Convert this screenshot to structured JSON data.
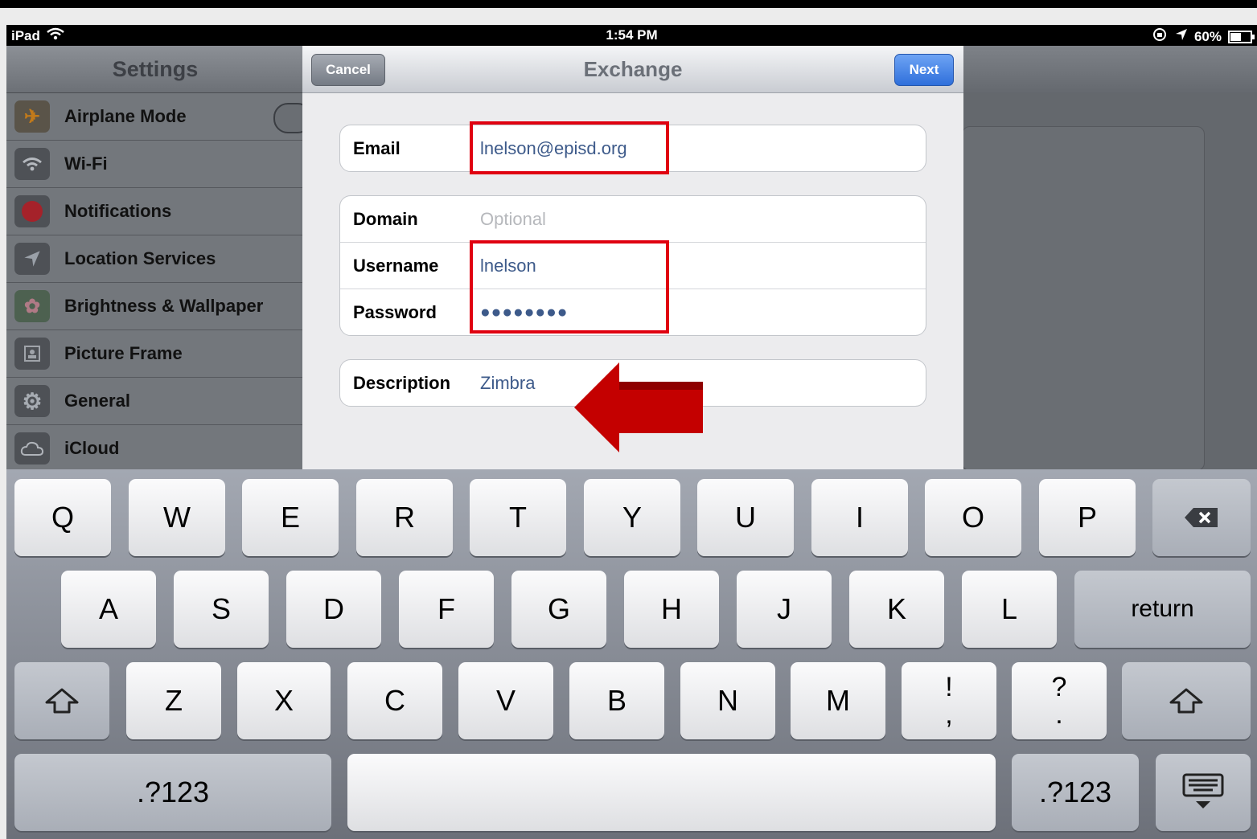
{
  "statusbar": {
    "device": "iPad",
    "time": "1:54 PM",
    "battery": "60%",
    "battery_level": 0.6
  },
  "settings": {
    "title": "Settings",
    "items": [
      {
        "label": "Airplane Mode",
        "icon": "airplane-icon"
      },
      {
        "label": "Wi-Fi",
        "icon": "wifi-icon"
      },
      {
        "label": "Notifications",
        "icon": "notifications-icon"
      },
      {
        "label": "Location Services",
        "icon": "location-icon"
      },
      {
        "label": "Brightness & Wallpaper",
        "icon": "flower-icon"
      },
      {
        "label": "Picture Frame",
        "icon": "picture-frame-icon"
      },
      {
        "label": "General",
        "icon": "gear-icon"
      },
      {
        "label": "iCloud",
        "icon": "cloud-icon"
      }
    ]
  },
  "modal": {
    "title": "Exchange",
    "cancel_label": "Cancel",
    "next_label": "Next",
    "email_label": "Email",
    "email_value": "lnelson@episd.org",
    "domain_label": "Domain",
    "domain_placeholder": "Optional",
    "username_label": "Username",
    "username_value": "lnelson",
    "password_label": "Password",
    "password_value": "●●●●●●●●",
    "description_label": "Description",
    "description_value": "Zimbra"
  },
  "keyboard": {
    "row1": [
      "Q",
      "W",
      "E",
      "R",
      "T",
      "Y",
      "U",
      "I",
      "O",
      "P"
    ],
    "row2": [
      "A",
      "S",
      "D",
      "F",
      "G",
      "H",
      "J",
      "K",
      "L"
    ],
    "return_label": "return",
    "row3": [
      "Z",
      "X",
      "C",
      "V",
      "B",
      "N",
      "M"
    ],
    "punct1": [
      "!",
      ","
    ],
    "punct2": [
      "?",
      "."
    ],
    "numbers_label": ".?123"
  },
  "colors": {
    "highlight": "#e00010",
    "arrow": "#c40000",
    "next_button": "#2f6fdb"
  }
}
